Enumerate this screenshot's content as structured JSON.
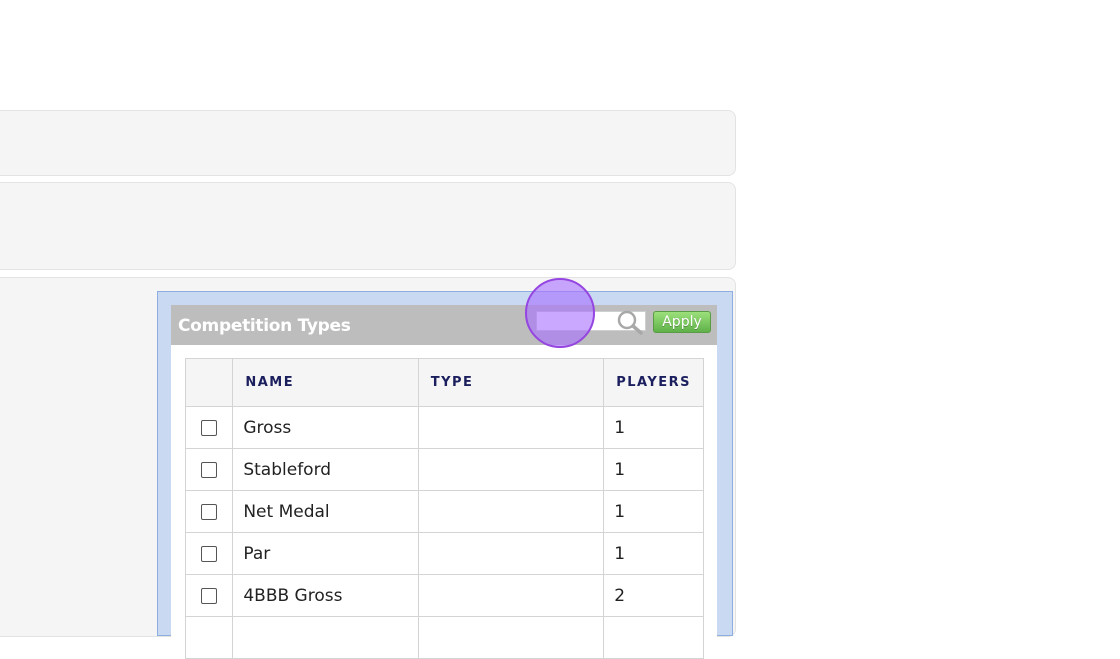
{
  "dialog": {
    "title": "Competition Types",
    "search": {
      "value": "",
      "placeholder": ""
    },
    "apply_label": "Apply"
  },
  "table": {
    "columns": [
      "NAME",
      "TYPE",
      "PLAYERS"
    ],
    "rows": [
      {
        "name": "Gross",
        "type": "",
        "players": "1"
      },
      {
        "name": "Stableford",
        "type": "",
        "players": "1"
      },
      {
        "name": "Net Medal",
        "type": "",
        "players": "1"
      },
      {
        "name": "Par",
        "type": "",
        "players": "1"
      },
      {
        "name": "4BBB Gross",
        "type": "",
        "players": "2"
      }
    ]
  },
  "colors": {
    "header_text": "#1c1f5e",
    "apply_button": "#6dbb53",
    "dialog_border": "#8eaee0",
    "cursor_highlight": "#a86eff"
  },
  "icons": {
    "search": "search-icon"
  }
}
